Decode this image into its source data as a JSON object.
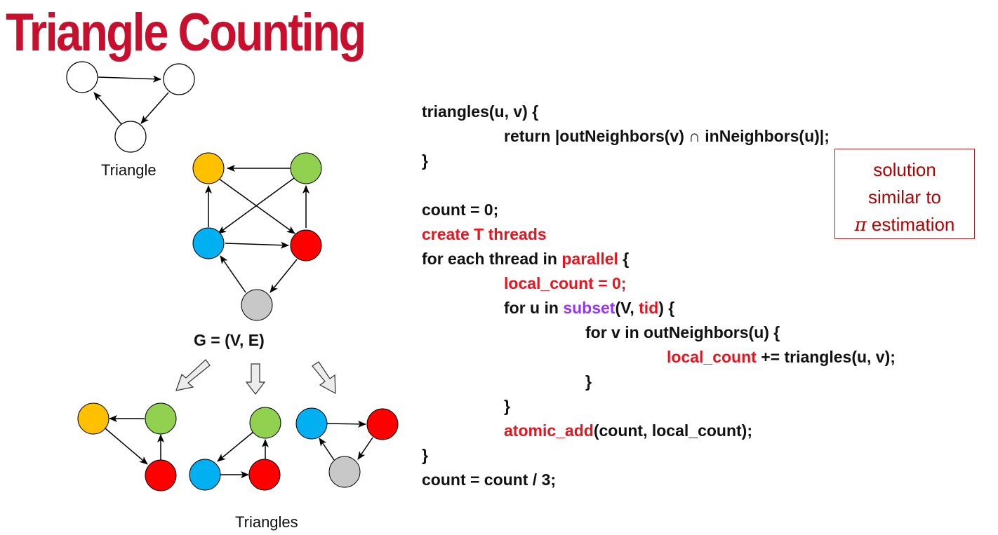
{
  "title": "Triangle Counting",
  "labels": {
    "triangle": "Triangle",
    "graph": "G = (V, E)",
    "triangles": "Triangles"
  },
  "colors": {
    "title": "#c8102e",
    "yellow": "#ffc000",
    "green": "#92d050",
    "blue": "#00b0f0",
    "red": "#ff0000",
    "gray": "#c8c8c8",
    "code_red": "#e8141e",
    "code_purple": "#9b30ff"
  },
  "code": {
    "l1": "triangles(u, v) {",
    "l2": "return |outNeighbors(v) ∩ inNeighbors(u)|;",
    "l3": "}",
    "l4": "count = 0;",
    "l5": "create T threads",
    "l6a": "for each thread in ",
    "l6b": "parallel",
    "l6c": " {",
    "l7": "local_count = 0;",
    "l8a": "for u in ",
    "l8b": "subset",
    "l8c": "(V, ",
    "l8d": "tid",
    "l8e": ") {",
    "l9": "for v in outNeighbors(u) {",
    "l10a": "local_count",
    "l10b": " += triangles(u, v);",
    "l11": "}",
    "l12": "}",
    "l13a": "atomic_add",
    "l13b": "(count, local_count);",
    "l14": "}",
    "l15": "count = count / 3;"
  },
  "note": {
    "line1": "solution",
    "line2": "similar to",
    "pi": "π",
    "line3": " estimation"
  }
}
